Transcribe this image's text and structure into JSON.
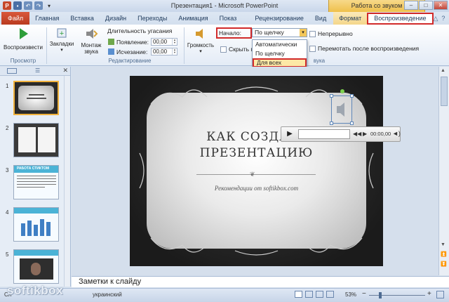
{
  "window": {
    "title": "Презентация1 - Microsoft PowerPoint",
    "contextual_tab": "Работа со звуком",
    "controls": [
      "–",
      "□",
      "✕"
    ]
  },
  "tabs": [
    "Файл",
    "Главная",
    "Вставка",
    "Дизайн",
    "Переходы",
    "Анимация",
    "Показ слайдов",
    "Рецензирование",
    "Вид",
    "Формат",
    "Воспроизведение"
  ],
  "ribbon": {
    "groups": {
      "preview": "Просмотр",
      "bookmarks": "",
      "editing": "Редактирование",
      "audio_options": "Параметры звука"
    },
    "play_label": "Воспроизвести",
    "bookmarks_label": "Закладки",
    "trim_label": "Монтаж звука",
    "fade_label": "Длительность угасания",
    "fade_in_label": "Появление:",
    "fade_in_value": "00,00",
    "fade_out_label": "Исчезание:",
    "fade_out_value": "00,00",
    "volume_label": "Громкость",
    "start_label": "Начало:",
    "start_value": "По щелчку",
    "hide_label": "Скрыть п",
    "loop_label": "Непрерывно",
    "rewind_label": "Перемотать после воспроизведения",
    "audio_group_tail": "вука"
  },
  "start_dropdown": {
    "options": [
      "Автоматически",
      "По щелчку",
      "Для всех слайдов"
    ],
    "highlighted": "Для всех слайдов"
  },
  "thumbnails": {
    "numbers": [
      "1",
      "2",
      "3",
      "4",
      "5"
    ],
    "slide3_title": "РАБОТА СТИКТОМ"
  },
  "slide": {
    "title_line1": "КАК СОЗДАТЬ",
    "title_line2": "ПРЕЗЕНТАЦИЮ",
    "subtitle": "Рекомендации от softikbox.com",
    "ornament": "❦"
  },
  "player": {
    "time": "00:00,00"
  },
  "notes": {
    "placeholder": "Заметки к слайду"
  },
  "status": {
    "language": "украинский",
    "zoom": "53%",
    "zoom_minus": "−",
    "zoom_plus": "+",
    "prefix": "Сл"
  },
  "watermark": "softikbox",
  "colors": {
    "file_tab": "#c6472a",
    "highlight_red": "#d12a2a",
    "contextual_gold": "#efc04b"
  }
}
